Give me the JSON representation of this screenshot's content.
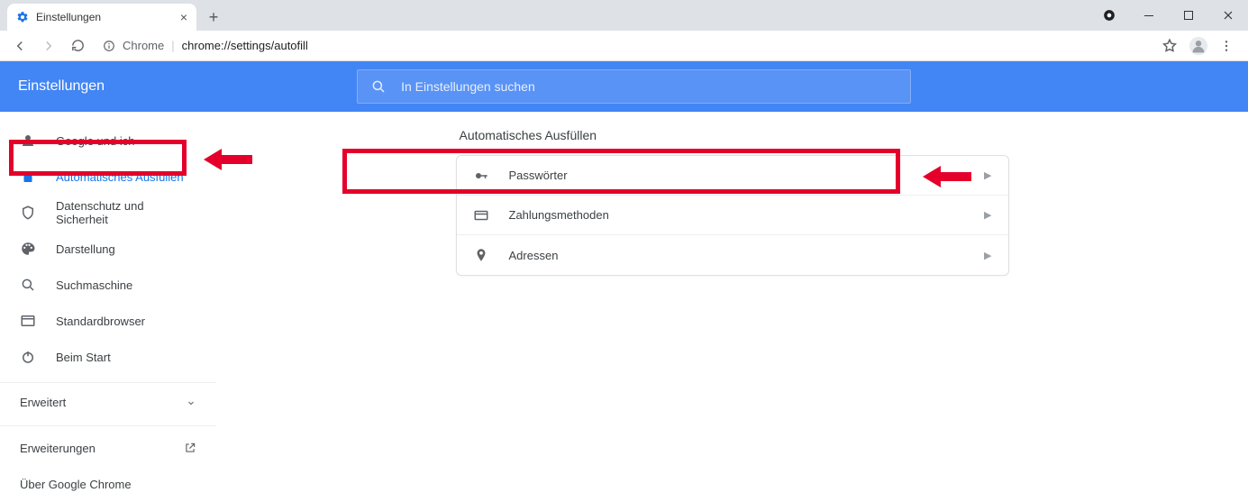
{
  "window": {
    "tab_title": "Einstellungen",
    "url_prefix": "Chrome",
    "url_path": "chrome://settings/autofill"
  },
  "header": {
    "title": "Einstellungen",
    "search_placeholder": "In Einstellungen suchen"
  },
  "sidebar": {
    "items": [
      {
        "label": "Google und ich"
      },
      {
        "label": "Automatisches Ausfüllen"
      },
      {
        "label": "Datenschutz und Sicherheit"
      },
      {
        "label": "Darstellung"
      },
      {
        "label": "Suchmaschine"
      },
      {
        "label": "Standardbrowser"
      },
      {
        "label": "Beim Start"
      }
    ],
    "expand_label": "Erweitert",
    "extensions_label": "Erweiterungen",
    "about_label": "Über Google Chrome"
  },
  "main": {
    "section_title": "Automatisches Ausfüllen",
    "rows": [
      {
        "label": "Passwörter"
      },
      {
        "label": "Zahlungsmethoden"
      },
      {
        "label": "Adressen"
      }
    ]
  },
  "colors": {
    "accent": "#4285f4",
    "highlight": "#e4002b"
  }
}
